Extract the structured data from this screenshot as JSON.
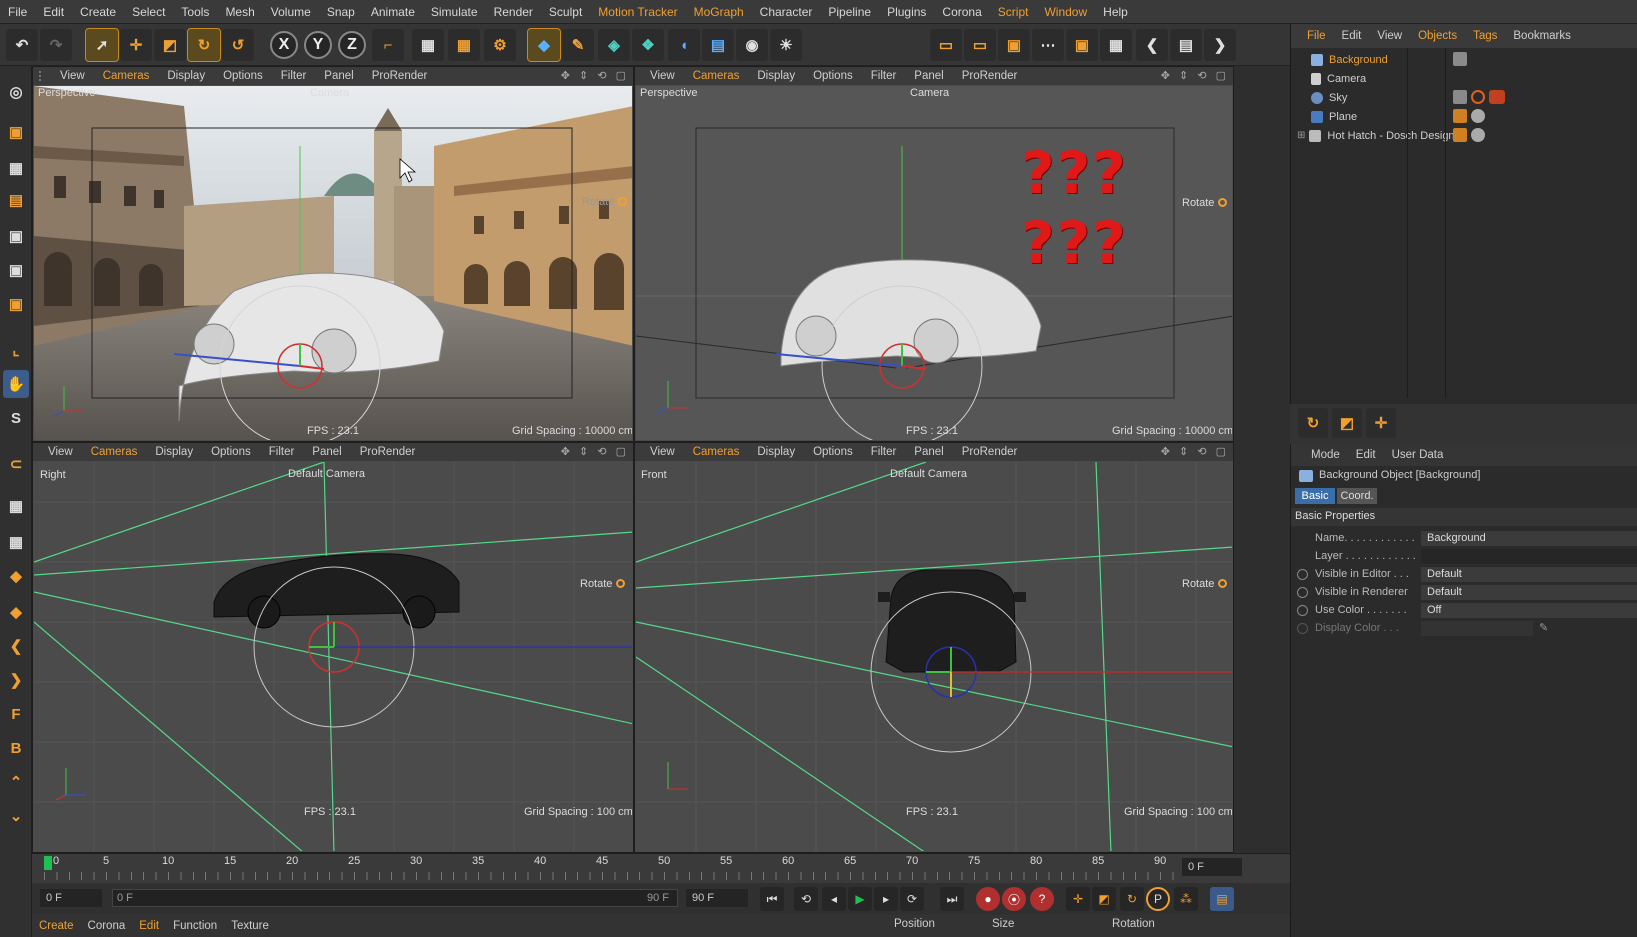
{
  "menubar": {
    "items": [
      "File",
      "Edit",
      "Create",
      "Select",
      "Tools",
      "Mesh",
      "Volume",
      "Snap",
      "Animate",
      "Simulate",
      "Render",
      "Sculpt",
      "Motion Tracker",
      "MoGraph",
      "Character",
      "Pipeline",
      "Plugins",
      "Corona",
      "Script",
      "Window",
      "Help"
    ]
  },
  "viewport_menu": [
    "View",
    "Cameras",
    "Display",
    "Options",
    "Filter",
    "Panel",
    "ProRender"
  ],
  "viewports": {
    "tl": {
      "mode": "Perspective",
      "camera": "Camera",
      "fps": "FPS : 23.1",
      "grid": "Grid Spacing : 10000 cm",
      "rotate": "Rotate"
    },
    "tr": {
      "mode": "Perspective",
      "camera": "Camera",
      "fps": "FPS : 23.1",
      "grid": "Grid Spacing : 10000 cm",
      "rotate": "Rotate",
      "overlay": "???"
    },
    "bl": {
      "mode": "Right",
      "camera": "Default Camera",
      "fps": "FPS : 23.1",
      "grid": "Grid Spacing : 100 cm",
      "rotate": "Rotate"
    },
    "br": {
      "mode": "Front",
      "camera": "Default Camera",
      "fps": "FPS : 23.1",
      "grid": "Grid Spacing : 100 cm",
      "rotate": "Rotate"
    }
  },
  "objects_panel": {
    "menu": [
      "File",
      "Edit",
      "View",
      "Objects",
      "Tags",
      "Bookmarks"
    ],
    "items": [
      "Background",
      "Camera",
      "Sky",
      "Plane",
      "Hot Hatch - Dosch Design"
    ]
  },
  "attributes": {
    "menu": [
      "Mode",
      "Edit",
      "User Data"
    ],
    "title": "Background Object [Background]",
    "tabs": [
      "Basic",
      "Coord."
    ],
    "section": "Basic Properties",
    "rows": [
      {
        "k": "Name. . . . . . . . . . . .",
        "v": "Background"
      },
      {
        "k": "Layer . . . . . . . . . . . .",
        "v": ""
      },
      {
        "k": "Visible in Editor . . .",
        "v": "Default"
      },
      {
        "k": "Visible in Renderer",
        "v": "Default"
      },
      {
        "k": "Use Color . . . . . . .",
        "v": "Off"
      },
      {
        "k": "Display Color . . .",
        "v": ""
      }
    ]
  },
  "timeline": {
    "ticks": [
      "0",
      "5",
      "10",
      "15",
      "20",
      "25",
      "30",
      "35",
      "40",
      "45",
      "50",
      "55",
      "60",
      "65",
      "70",
      "75",
      "80",
      "85",
      "90"
    ],
    "current_frame": "0 F",
    "start": "0 F",
    "range_start": "0 F",
    "range_end": "90 F",
    "end": "90 F"
  },
  "bottom": {
    "left_menu": [
      "Create",
      "Corona",
      "Edit",
      "Function",
      "Texture"
    ],
    "right_cols": [
      "Position",
      "Size",
      "Rotation"
    ]
  },
  "colors": {
    "accent": "#f0a030",
    "question": "#e01818",
    "grid_green": "#55d98a"
  }
}
